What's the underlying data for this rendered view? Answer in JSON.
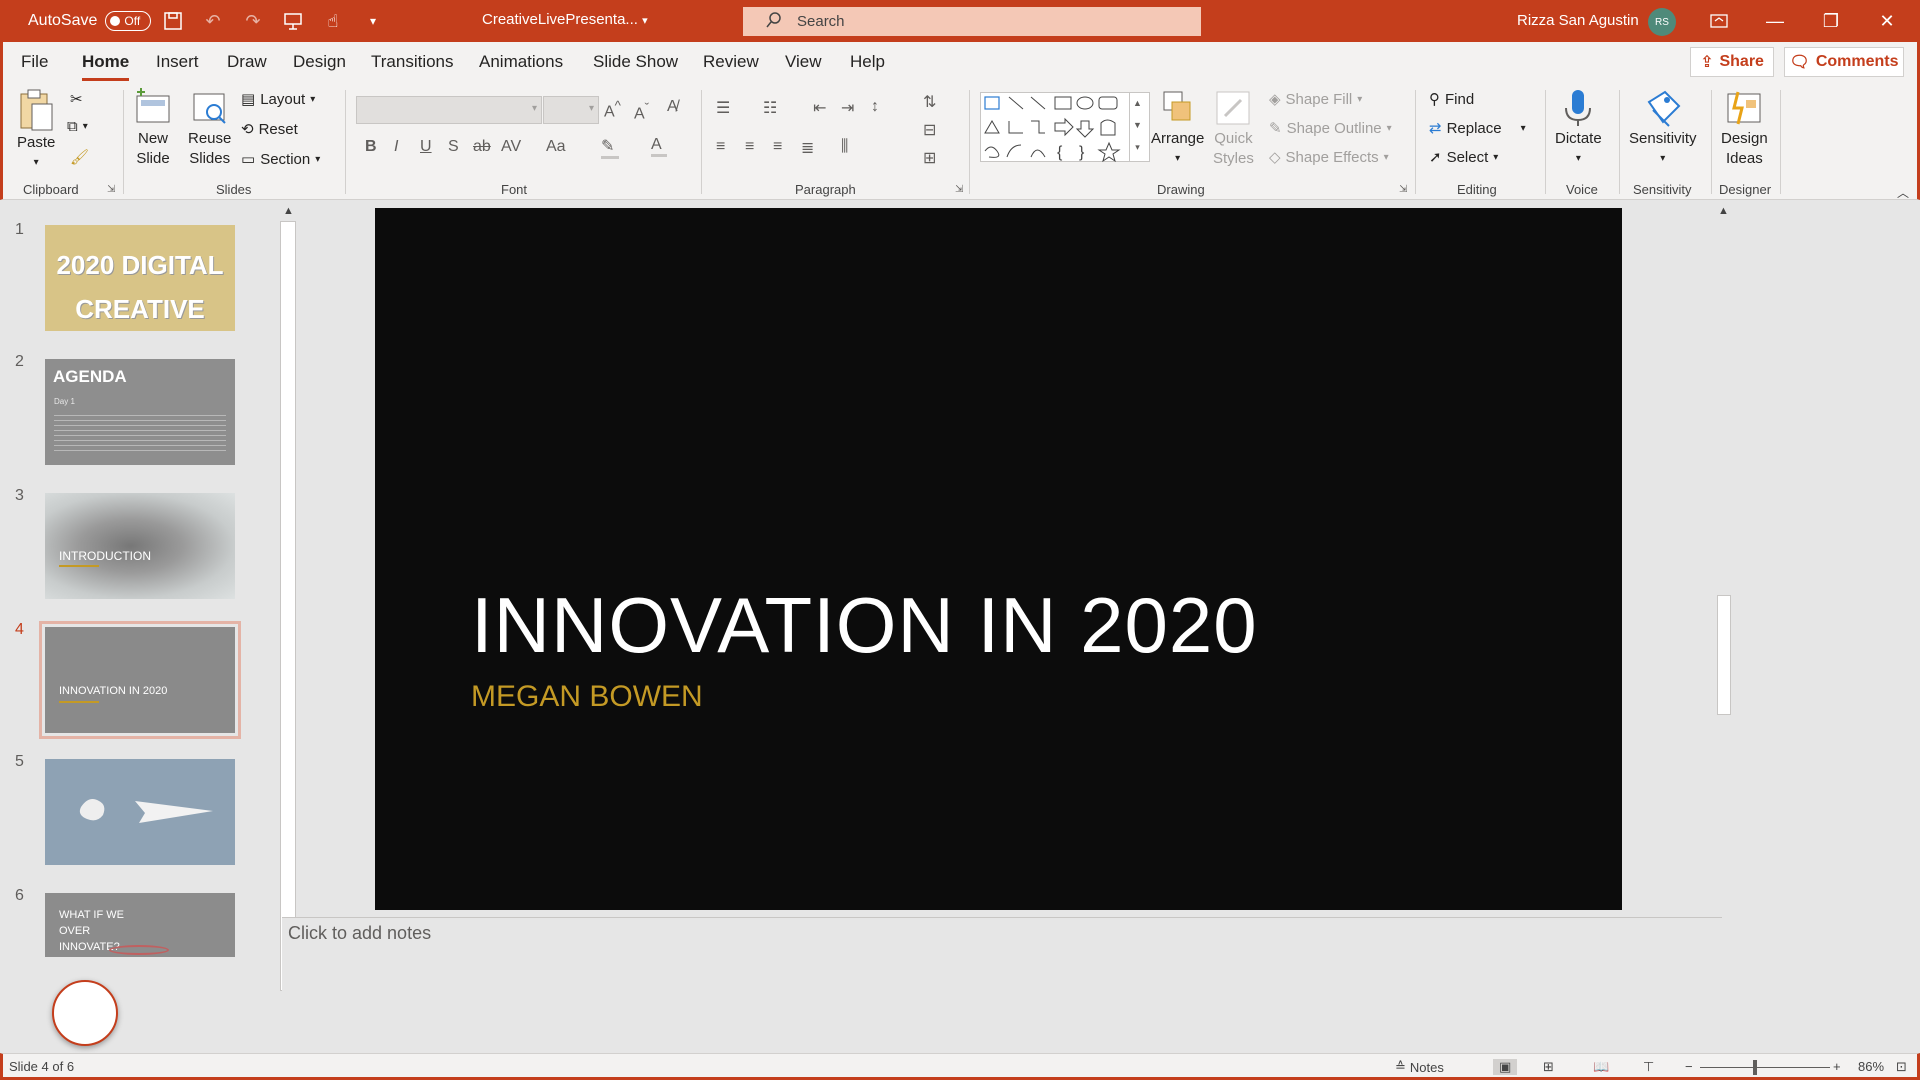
{
  "titlebar": {
    "autosave_label": "AutoSave",
    "autosave_state": "Off",
    "filename": "CreativeLivePresenta...",
    "search_placeholder": "Search",
    "user_name": "Rizza San Agustin",
    "user_initials": "RS"
  },
  "tabs": [
    "File",
    "Home",
    "Insert",
    "Draw",
    "Design",
    "Transitions",
    "Animations",
    "Slide Show",
    "Review",
    "View",
    "Help"
  ],
  "active_tab": "Home",
  "share_label": "Share",
  "comments_label": "Comments",
  "ribbon": {
    "clipboard": {
      "paste": "Paste",
      "group": "Clipboard"
    },
    "slides": {
      "new_slide_1": "New",
      "new_slide_2": "Slide",
      "reuse_1": "Reuse",
      "reuse_2": "Slides",
      "layout": "Layout",
      "reset": "Reset",
      "section": "Section",
      "group": "Slides"
    },
    "font": {
      "group": "Font"
    },
    "paragraph": {
      "group": "Paragraph"
    },
    "drawing": {
      "arrange": "Arrange",
      "quick_1": "Quick",
      "quick_2": "Styles",
      "shape_fill": "Shape Fill",
      "shape_outline": "Shape Outline",
      "shape_effects": "Shape Effects",
      "group": "Drawing"
    },
    "editing": {
      "find": "Find",
      "replace": "Replace",
      "select": "Select",
      "group": "Editing"
    },
    "voice": {
      "dictate": "Dictate",
      "group": "Voice"
    },
    "sensitivity": {
      "label": "Sensitivity",
      "group": "Sensitivity"
    },
    "designer": {
      "ideas_1": "Design",
      "ideas_2": "Ideas",
      "group": "Designer"
    }
  },
  "thumbnails": [
    {
      "num": "1",
      "line1": "2020 DIGITAL",
      "line2": "CREATIVE LIVE"
    },
    {
      "num": "2",
      "title": "AGENDA",
      "sub": "Day 1"
    },
    {
      "num": "3",
      "title": "INTRODUCTION"
    },
    {
      "num": "4",
      "title": "INNOVATION IN 2020"
    },
    {
      "num": "5"
    },
    {
      "num": "6",
      "line1": "WHAT IF WE",
      "line2": "OVER",
      "line3": "INNOVATE?"
    }
  ],
  "slide": {
    "title": "INNOVATION IN 2020",
    "subtitle": "MEGAN BOWEN"
  },
  "notes_placeholder": "Click to add notes",
  "status": {
    "slide_count": "Slide 4 of 6",
    "notes": "Notes",
    "zoom": "86%"
  },
  "colors": {
    "accent": "#c43e1c",
    "subtitle": "#c49a25",
    "slide_bg": "#0c0c0c"
  }
}
